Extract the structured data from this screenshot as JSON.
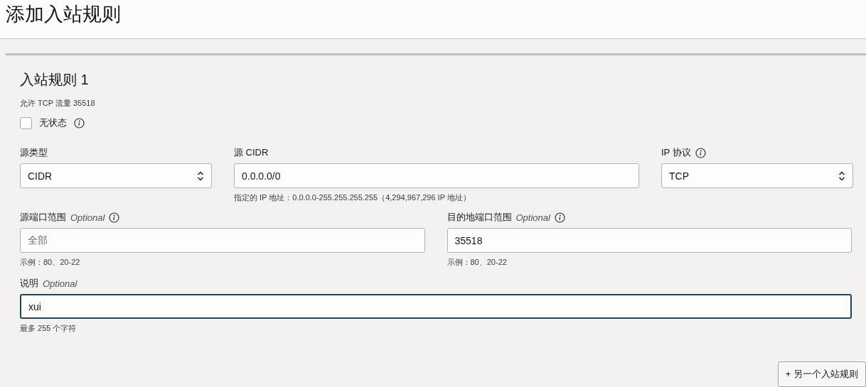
{
  "page_title": "添加入站规则",
  "rule": {
    "title": "入站规则 1",
    "summary": "允许 TCP 流量 35518",
    "stateless": {
      "label": "无状态",
      "checked": false,
      "info": true
    },
    "rows": [
      [
        {
          "kind": "select",
          "label": "源类型",
          "value": "CIDR",
          "info": false,
          "focused": false
        },
        {
          "kind": "input",
          "label": "源 CIDR",
          "value": "0.0.0.0/0",
          "info": false,
          "focused": false,
          "help": "指定的 IP 地址：0.0.0.0-255.255.255.255（4,294,967,296 IP 地址）"
        },
        {
          "kind": "select",
          "label": "IP 协议",
          "value": "TCP",
          "info": true,
          "focused": false
        }
      ],
      [
        {
          "kind": "input",
          "label": "源端口范围",
          "optional": "Optional",
          "placeholder": "全部",
          "info": true,
          "focused": false,
          "help": "示例：80、20-22"
        },
        {
          "kind": "input",
          "label": "目的地端口范围",
          "optional": "Optional",
          "value": "35518",
          "info": true,
          "focused": false,
          "help": "示例：80、20-22"
        }
      ],
      [
        {
          "kind": "input",
          "label": "说明",
          "optional": "Optional",
          "value": "xui",
          "info": false,
          "focused": true,
          "help": "最多 255 个字符"
        }
      ]
    ]
  },
  "add_button": "+ 另一个入站规则"
}
